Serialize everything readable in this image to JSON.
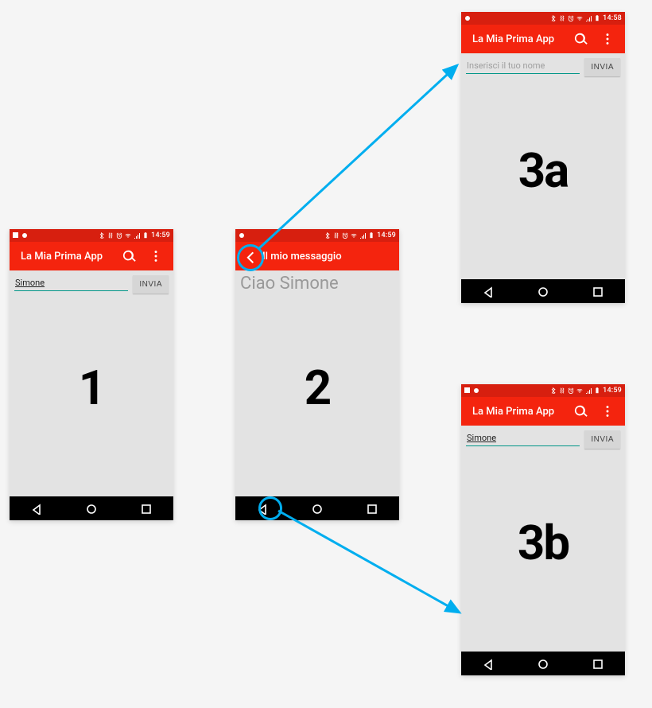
{
  "status": {
    "time": "14:59",
    "time_3a": "14:58",
    "time_3b": "14:59"
  },
  "app_title": "La Mia Prima App",
  "screen2_title": "Il mio messaggio",
  "send_button": "INVIA",
  "input_value_filled": "Simone",
  "input_placeholder_empty": "Inserisci il tuo nome",
  "screen2_message": "Ciao Simone",
  "labels": {
    "s1": "1",
    "s2": "2",
    "s3a": "3a",
    "s3b": "3b"
  },
  "highlight_color": "#00aeef",
  "brand_color": "#f4240e"
}
